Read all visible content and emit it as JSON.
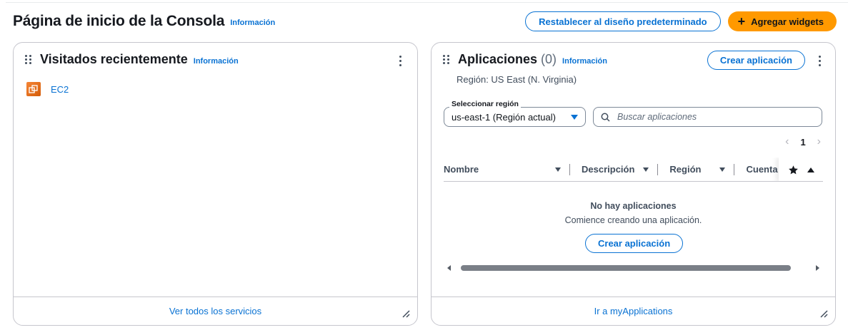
{
  "header": {
    "title": "Página de inicio de la Consola",
    "info_link": "Información",
    "reset_button": "Restablecer al diseño predeterminado",
    "add_widgets_button": "Agregar widgets"
  },
  "recently_visited": {
    "title": "Visitados recientemente",
    "info_link": "Información",
    "items": [
      {
        "label": "EC2",
        "icon": "ec2-service-icon"
      }
    ],
    "footer_link": "Ver todos los servicios"
  },
  "applications": {
    "title": "Aplicaciones",
    "count": "(0)",
    "info_link": "Información",
    "create_button": "Crear aplicación",
    "region_text": "Región: US East (N. Virginia)",
    "region_select": {
      "label": "Seleccionar región",
      "value": "us-east-1 (Región actual)"
    },
    "search": {
      "placeholder": "Buscar aplicaciones"
    },
    "pagination": {
      "current_page": "1"
    },
    "columns": [
      "Nombre",
      "Descripción",
      "Región",
      "Cuenta or"
    ],
    "empty_state": {
      "title": "No hay aplicaciones",
      "subtitle": "Comience creando una aplicación.",
      "button": "Crear aplicación"
    },
    "footer_link": "Ir a myApplications"
  },
  "colors": {
    "accent": "#0972d3",
    "primary_button": "#ff9900",
    "ec2_icon": "#e8721c"
  }
}
